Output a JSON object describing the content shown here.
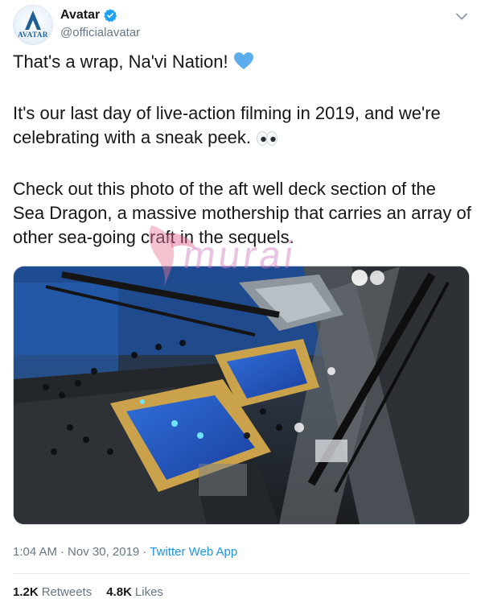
{
  "account": {
    "display_name": "Avatar",
    "handle": "@officialavatar",
    "verified": true,
    "avatar_logo_text": "AVATAR"
  },
  "tweet": {
    "line1": "That's a wrap, Na'vi Nation!",
    "line1_emoji": "blue-heart-icon",
    "para2": "It's our last day of live-action filming in 2019, and we're celebrating with a sneak peek.",
    "para2_emoji": "eyes-icon",
    "para3": "Check out this photo of the aft well deck section of the Sea Dragon, a massive mothership that carries an array of other sea-going craft in the sequels."
  },
  "watermark": {
    "text": "murai"
  },
  "meta": {
    "time": "1:04 AM",
    "separator": "·",
    "date": "Nov 30, 2019",
    "separator2": "·",
    "source": "Twitter Web App"
  },
  "stats": {
    "retweets_count": "1.2K",
    "retweets_label": "Retweets",
    "likes_count": "4.8K",
    "likes_label": "Likes"
  },
  "colors": {
    "link": "#1b95e0",
    "verified": "#1da1f2",
    "muted": "#657786",
    "heart": "#5dadec"
  }
}
